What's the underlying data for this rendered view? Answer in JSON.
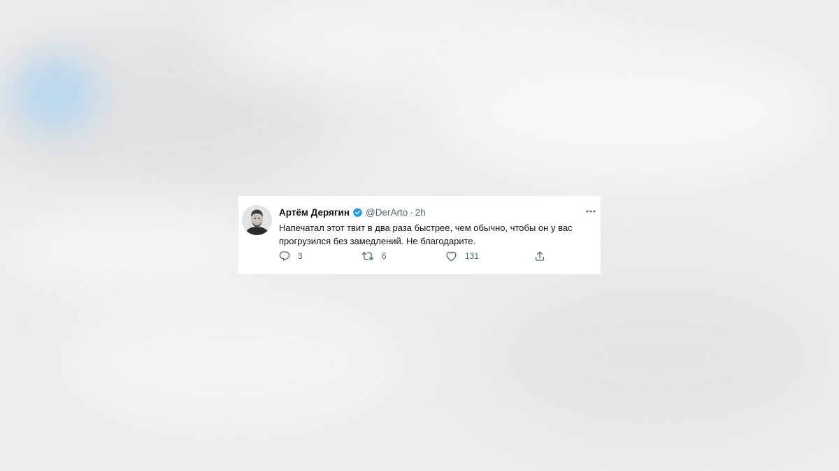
{
  "tweet": {
    "author_name": "Артём Дерягин",
    "handle": "@DerArto",
    "separator": "·",
    "time": "2h",
    "text_line1": "Напечатал этот твит в два раза быстрее, чем обычно, чтобы он у вас",
    "text_line2": "прогрузился без замедлений. Не благодарите.",
    "reply_count": "3",
    "retweet_count": "6",
    "like_count": "131"
  },
  "colors": {
    "verified": "#1d9bf0",
    "text_primary": "#0f1419",
    "text_secondary": "#536471",
    "background_blur": "#ececec"
  },
  "icons": {
    "more": "more-dots-icon",
    "reply": "reply-icon",
    "retweet": "retweet-icon",
    "like": "heart-icon",
    "share": "share-icon",
    "verified": "verified-badge-icon"
  }
}
